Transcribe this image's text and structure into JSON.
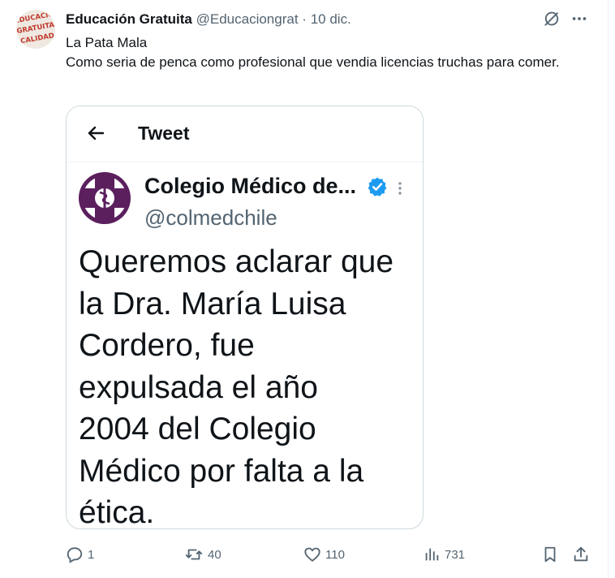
{
  "author": {
    "name": "Educación Gratuita",
    "handle": "@Educaciongrat",
    "separator": "·",
    "date": "10 dic.",
    "avatar_text": [
      "EDUCACIÓN",
      "GRATUITA",
      "CALIDAD"
    ]
  },
  "body": {
    "lines": [
      "La Pata Mala",
      "Como seria de penca como profesional que vendia licencias truchas para comer."
    ]
  },
  "card": {
    "header_title": "Tweet",
    "org_name": "Colegio Médico de...",
    "org_handle": "@colmedchile",
    "quote_lines": [
      "Queremos aclarar que",
      "la Dra. María Luisa",
      "Cordero, fue",
      "expulsada el año",
      "2004 del Colegio",
      "Médico por falta a la",
      "ética."
    ]
  },
  "actions": {
    "replies": "1",
    "retweets": "40",
    "likes": "110",
    "views": "731"
  },
  "colors": {
    "text_primary": "#0f1419",
    "text_secondary": "#536471",
    "verified_blue": "#1d9bf0",
    "logo_purple": "#5b1f5e"
  },
  "icons": [
    "grok-icon",
    "more-icon",
    "back-arrow-icon",
    "verified-badge-icon",
    "kebab-icon",
    "reply-icon",
    "retweet-icon",
    "like-icon",
    "views-icon",
    "bookmark-icon",
    "share-icon"
  ]
}
